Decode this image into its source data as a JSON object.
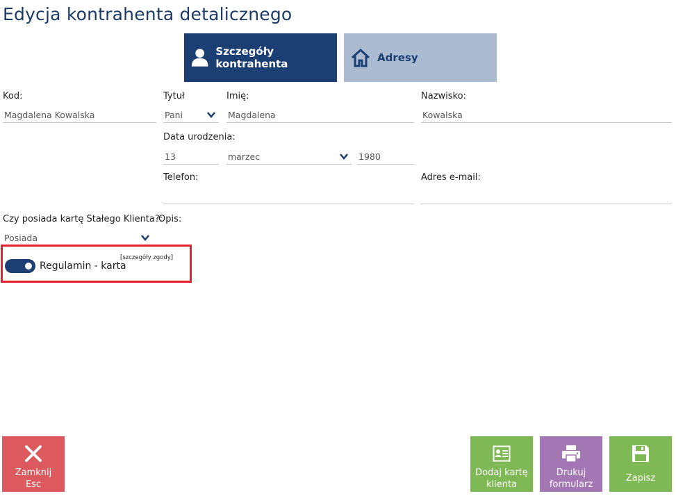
{
  "page": {
    "title": "Edycja kontrahenta detalicznego"
  },
  "tabs": {
    "details": "Szczegóły kontrahenta",
    "addresses": "Adresy"
  },
  "form": {
    "code": {
      "label": "Kod:",
      "value": "Magdalena Kowalska"
    },
    "title": {
      "label": "Tytuł",
      "value": "Pani"
    },
    "first_name": {
      "label": "Imię:",
      "value": "Magdalena"
    },
    "last_name": {
      "label": "Nazwisko:",
      "value": "Kowalska"
    },
    "birth_date": {
      "label": "Data urodzenia:",
      "day": "13",
      "month": "marzec",
      "year": "1980"
    },
    "phone": {
      "label": "Telefon:",
      "value": ""
    },
    "email": {
      "label": "Adres e-mail:",
      "value": ""
    },
    "loyalty_card": {
      "label": "Czy posiada kartę Stałego Klienta?:",
      "value": "Posiada"
    },
    "description": {
      "label": "Opis:"
    }
  },
  "consent": {
    "label": "Regulamin - karta",
    "details_link": "[szczegóły zgody]",
    "enabled": true
  },
  "actions": {
    "close_line1": "Zamknij",
    "close_line2": "Esc",
    "add_card_line1": "Dodaj kartę",
    "add_card_line2": "klienta",
    "print_line1": "Drukuj",
    "print_line2": "formularz",
    "save": "Zapisz"
  },
  "icons": {
    "details_tab": "user-icon",
    "addresses_tab": "home-icon",
    "close": "close-icon",
    "add_card": "id-card-icon",
    "print": "printer-icon",
    "save": "floppy-disk-icon"
  },
  "colors": {
    "accent": "#1c3f73",
    "tab_inactive": "#abbbd1",
    "close": "#dc5a5e",
    "green": "#7fb955",
    "purple": "#a377b4",
    "highlight": "#e3202b"
  }
}
